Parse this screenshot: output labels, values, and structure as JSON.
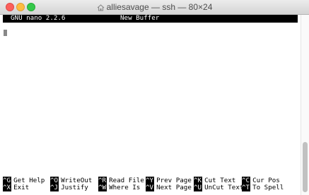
{
  "window": {
    "title": "alliesavage — ssh — 80×24"
  },
  "nano": {
    "version": "GNU nano 2.2.6",
    "buffer": "New Buffer"
  },
  "shortcuts": {
    "row1": [
      {
        "key": "^G",
        "label": "Get Help"
      },
      {
        "key": "^O",
        "label": "WriteOut"
      },
      {
        "key": "^R",
        "label": "Read File"
      },
      {
        "key": "^Y",
        "label": "Prev Page"
      },
      {
        "key": "^K",
        "label": "Cut Text"
      },
      {
        "key": "^C",
        "label": "Cur Pos"
      }
    ],
    "row2": [
      {
        "key": "^X",
        "label": "Exit"
      },
      {
        "key": "^J",
        "label": "Justify"
      },
      {
        "key": "^W",
        "label": "Where Is"
      },
      {
        "key": "^V",
        "label": "Next Page"
      },
      {
        "key": "^U",
        "label": "UnCut Text"
      },
      {
        "key": "^T",
        "label": "To Spell"
      }
    ]
  },
  "colors": {
    "close": "#fc605c",
    "minimize": "#fdbc40",
    "maximize": "#34c84a",
    "terminal_bg": "#ffffff",
    "terminal_fg": "#000000"
  }
}
